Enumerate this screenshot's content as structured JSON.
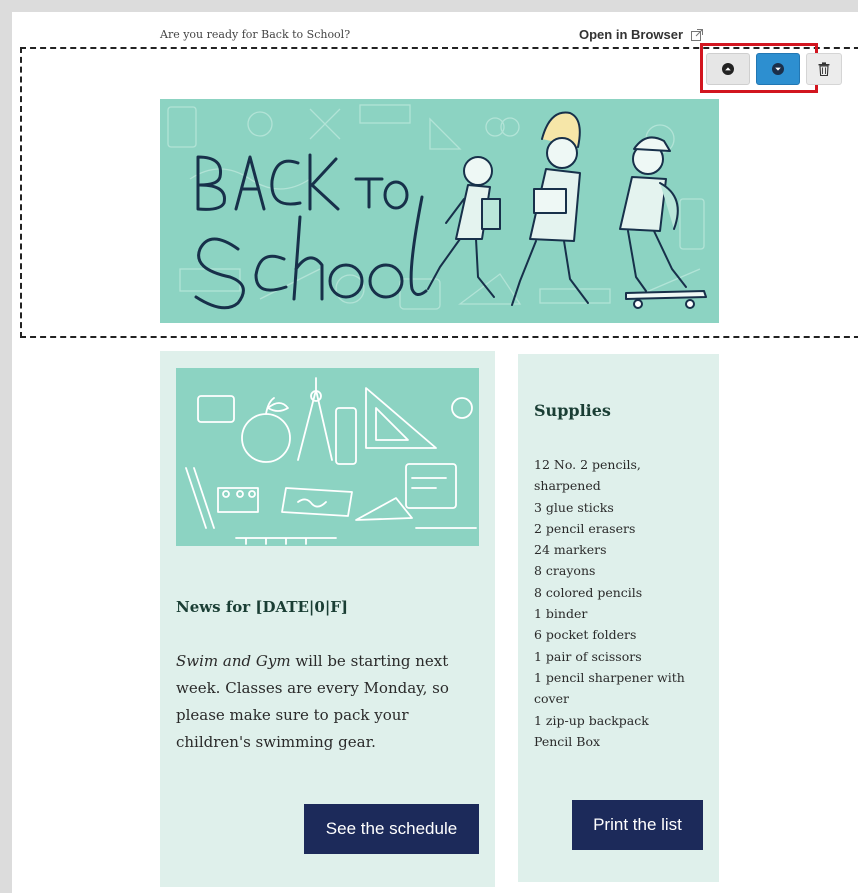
{
  "preheader": {
    "text": "Are you ready for Back to School?"
  },
  "open_in_browser": {
    "label": "Open in Browser",
    "icon": "external-link-icon"
  },
  "toolbar": {
    "move_up_icon": "arrow-up-icon",
    "move_down_icon": "arrow-down-icon",
    "delete_icon": "trash-icon",
    "accent_color": "#2d8fd0",
    "highlight_color": "#d2151f"
  },
  "hero": {
    "line1": "BACK TO",
    "line2": "school"
  },
  "news": {
    "title": "News for [DATE|0|F]",
    "body_italic": "Swim and Gym",
    "body_rest": " will be starting next week. Classes are every Monday, so please make sure to pack your children's swimming gear.",
    "button_label": "See the schedule"
  },
  "supplies": {
    "title": "Supplies",
    "items": [
      "12 No. 2 pencils, sharpened",
      "3 glue sticks",
      "2 pencil erasers",
      "24 markers",
      "8 crayons",
      "8 colored pencils",
      "1 binder",
      "6 pocket folders",
      "1 pair of scissors",
      "1 pencil sharpener with cover",
      "1 zip-up backpack",
      "Pencil Box"
    ],
    "button_label": "Print the list"
  },
  "colors": {
    "mint": "#8cd3c2",
    "card_bg": "#dff0eb",
    "navy_button": "#1c2a5a",
    "heading_green": "#1a3e34"
  }
}
